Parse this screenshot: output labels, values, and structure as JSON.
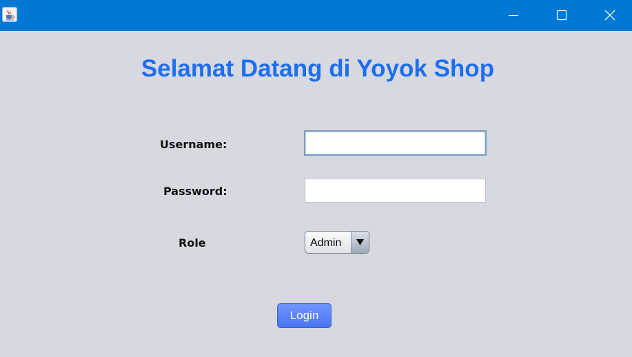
{
  "window": {
    "icon": "java-cup-icon",
    "controls": [
      "minimize-icon",
      "maximize-icon",
      "close-icon"
    ],
    "titlebar_color": "#0078d4",
    "background_color": "#d6d9e0"
  },
  "main": {
    "heading": "Selamat Datang di Yoyok Shop",
    "heading_color": "#1e6ef0",
    "username_label": "Username:",
    "username_value": "",
    "password_label": "Password:",
    "password_value": "",
    "role_label": "Role",
    "role_selected": "Admin",
    "login_label": "Login",
    "login_color": "#4a74f2"
  }
}
